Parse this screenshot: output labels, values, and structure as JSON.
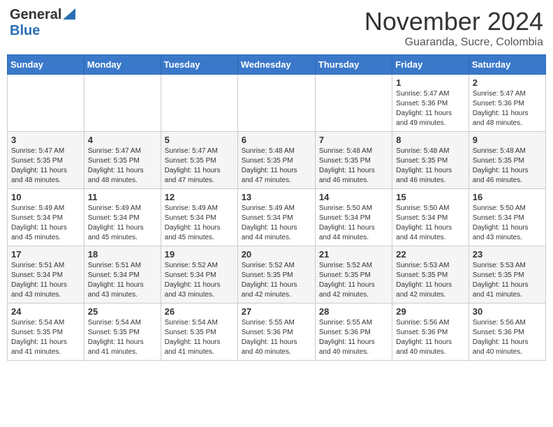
{
  "header": {
    "logo_general": "General",
    "logo_blue": "Blue",
    "month_title": "November 2024",
    "location": "Guaranda, Sucre, Colombia"
  },
  "days_of_week": [
    "Sunday",
    "Monday",
    "Tuesday",
    "Wednesday",
    "Thursday",
    "Friday",
    "Saturday"
  ],
  "weeks": [
    {
      "row": 1,
      "cells": [
        {
          "day": "",
          "info": ""
        },
        {
          "day": "",
          "info": ""
        },
        {
          "day": "",
          "info": ""
        },
        {
          "day": "",
          "info": ""
        },
        {
          "day": "",
          "info": ""
        },
        {
          "day": "1",
          "info": "Sunrise: 5:47 AM\nSunset: 5:36 PM\nDaylight: 11 hours\nand 49 minutes."
        },
        {
          "day": "2",
          "info": "Sunrise: 5:47 AM\nSunset: 5:36 PM\nDaylight: 11 hours\nand 48 minutes."
        }
      ]
    },
    {
      "row": 2,
      "cells": [
        {
          "day": "3",
          "info": "Sunrise: 5:47 AM\nSunset: 5:35 PM\nDaylight: 11 hours\nand 48 minutes."
        },
        {
          "day": "4",
          "info": "Sunrise: 5:47 AM\nSunset: 5:35 PM\nDaylight: 11 hours\nand 48 minutes."
        },
        {
          "day": "5",
          "info": "Sunrise: 5:47 AM\nSunset: 5:35 PM\nDaylight: 11 hours\nand 47 minutes."
        },
        {
          "day": "6",
          "info": "Sunrise: 5:48 AM\nSunset: 5:35 PM\nDaylight: 11 hours\nand 47 minutes."
        },
        {
          "day": "7",
          "info": "Sunrise: 5:48 AM\nSunset: 5:35 PM\nDaylight: 11 hours\nand 46 minutes."
        },
        {
          "day": "8",
          "info": "Sunrise: 5:48 AM\nSunset: 5:35 PM\nDaylight: 11 hours\nand 46 minutes."
        },
        {
          "day": "9",
          "info": "Sunrise: 5:48 AM\nSunset: 5:35 PM\nDaylight: 11 hours\nand 46 minutes."
        }
      ]
    },
    {
      "row": 3,
      "cells": [
        {
          "day": "10",
          "info": "Sunrise: 5:49 AM\nSunset: 5:34 PM\nDaylight: 11 hours\nand 45 minutes."
        },
        {
          "day": "11",
          "info": "Sunrise: 5:49 AM\nSunset: 5:34 PM\nDaylight: 11 hours\nand 45 minutes."
        },
        {
          "day": "12",
          "info": "Sunrise: 5:49 AM\nSunset: 5:34 PM\nDaylight: 11 hours\nand 45 minutes."
        },
        {
          "day": "13",
          "info": "Sunrise: 5:49 AM\nSunset: 5:34 PM\nDaylight: 11 hours\nand 44 minutes."
        },
        {
          "day": "14",
          "info": "Sunrise: 5:50 AM\nSunset: 5:34 PM\nDaylight: 11 hours\nand 44 minutes."
        },
        {
          "day": "15",
          "info": "Sunrise: 5:50 AM\nSunset: 5:34 PM\nDaylight: 11 hours\nand 44 minutes."
        },
        {
          "day": "16",
          "info": "Sunrise: 5:50 AM\nSunset: 5:34 PM\nDaylight: 11 hours\nand 43 minutes."
        }
      ]
    },
    {
      "row": 4,
      "cells": [
        {
          "day": "17",
          "info": "Sunrise: 5:51 AM\nSunset: 5:34 PM\nDaylight: 11 hours\nand 43 minutes."
        },
        {
          "day": "18",
          "info": "Sunrise: 5:51 AM\nSunset: 5:34 PM\nDaylight: 11 hours\nand 43 minutes."
        },
        {
          "day": "19",
          "info": "Sunrise: 5:52 AM\nSunset: 5:34 PM\nDaylight: 11 hours\nand 43 minutes."
        },
        {
          "day": "20",
          "info": "Sunrise: 5:52 AM\nSunset: 5:35 PM\nDaylight: 11 hours\nand 42 minutes."
        },
        {
          "day": "21",
          "info": "Sunrise: 5:52 AM\nSunset: 5:35 PM\nDaylight: 11 hours\nand 42 minutes."
        },
        {
          "day": "22",
          "info": "Sunrise: 5:53 AM\nSunset: 5:35 PM\nDaylight: 11 hours\nand 42 minutes."
        },
        {
          "day": "23",
          "info": "Sunrise: 5:53 AM\nSunset: 5:35 PM\nDaylight: 11 hours\nand 41 minutes."
        }
      ]
    },
    {
      "row": 5,
      "cells": [
        {
          "day": "24",
          "info": "Sunrise: 5:54 AM\nSunset: 5:35 PM\nDaylight: 11 hours\nand 41 minutes."
        },
        {
          "day": "25",
          "info": "Sunrise: 5:54 AM\nSunset: 5:35 PM\nDaylight: 11 hours\nand 41 minutes."
        },
        {
          "day": "26",
          "info": "Sunrise: 5:54 AM\nSunset: 5:35 PM\nDaylight: 11 hours\nand 41 minutes."
        },
        {
          "day": "27",
          "info": "Sunrise: 5:55 AM\nSunset: 5:36 PM\nDaylight: 11 hours\nand 40 minutes."
        },
        {
          "day": "28",
          "info": "Sunrise: 5:55 AM\nSunset: 5:36 PM\nDaylight: 11 hours\nand 40 minutes."
        },
        {
          "day": "29",
          "info": "Sunrise: 5:56 AM\nSunset: 5:36 PM\nDaylight: 11 hours\nand 40 minutes."
        },
        {
          "day": "30",
          "info": "Sunrise: 5:56 AM\nSunset: 5:36 PM\nDaylight: 11 hours\nand 40 minutes."
        }
      ]
    }
  ]
}
